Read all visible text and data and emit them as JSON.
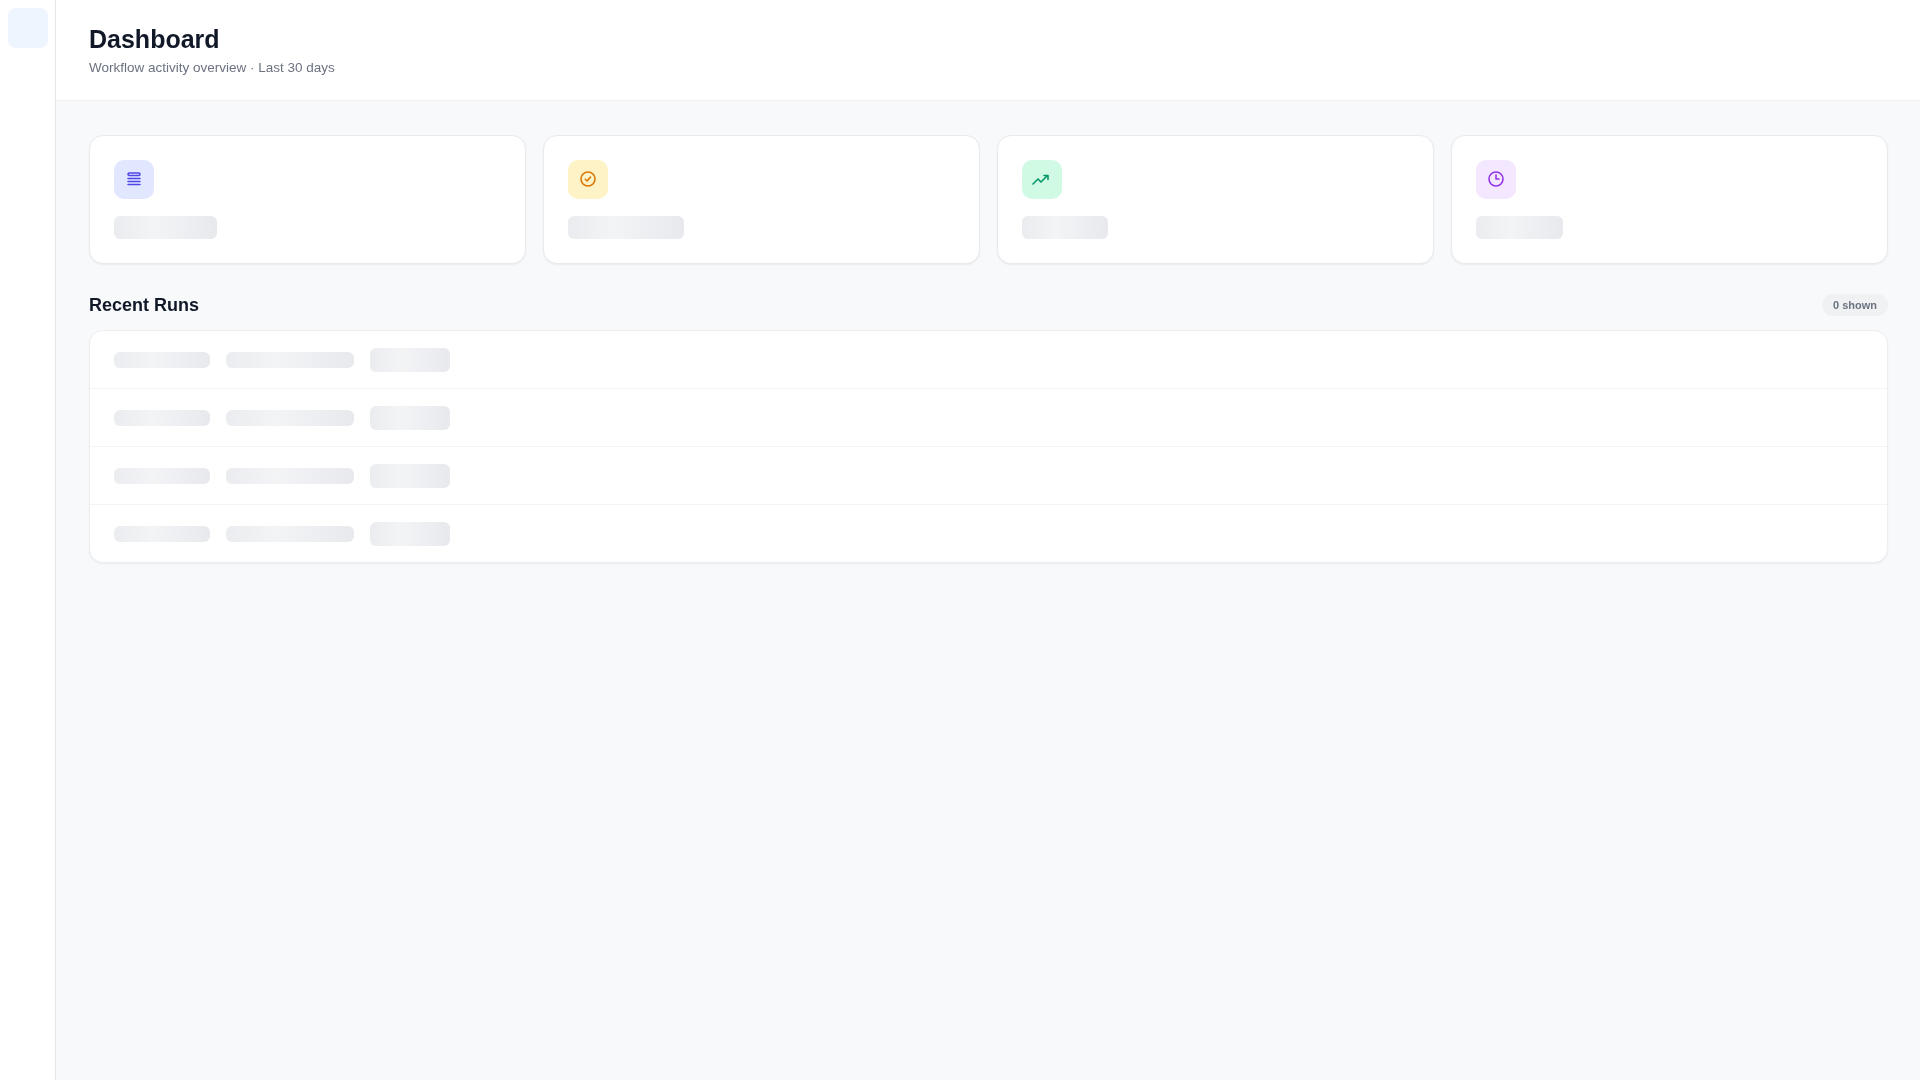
{
  "header": {
    "title": "Dashboard",
    "subtitle": "Workflow activity overview · Last 30 days"
  },
  "stat_cards": [
    {
      "kind": "runs"
    },
    {
      "kind": "success"
    },
    {
      "kind": "trend"
    },
    {
      "kind": "duration"
    }
  ],
  "recent_runs": {
    "title": "Recent Runs",
    "badge": "0 shown",
    "rows": [
      {
        "kind": "skeleton"
      },
      {
        "kind": "skeleton"
      },
      {
        "kind": "skeleton"
      },
      {
        "kind": "skeleton"
      }
    ]
  }
}
